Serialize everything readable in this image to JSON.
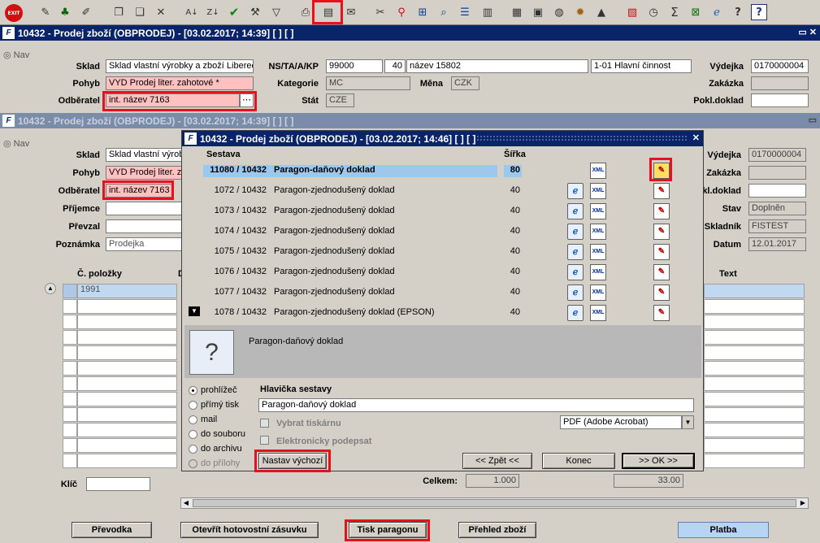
{
  "toolbar": {
    "exit_label": "EXIT",
    "icons": [
      "exit-icon",
      "new-record-icon",
      "tree-icon",
      "eraser-icon",
      "copy-icon",
      "paste-icon",
      "delete-icon",
      "sort-az-icon",
      "sort-za-icon",
      "check-icon",
      "wrench-icon",
      "filter-icon",
      "print-icon",
      "print-report-icon",
      "mail-icon",
      "cut-icon",
      "attach-icon",
      "tree-view-icon",
      "search-icon",
      "list-icon",
      "columns-icon",
      "table-icon",
      "report-icon",
      "globe-icon",
      "wheel-icon",
      "mountain-icon",
      "chart-icon",
      "clock-icon",
      "sum-icon",
      "excel-icon",
      "web-icon",
      "help-icon",
      "help-book-icon"
    ]
  },
  "back_window": {
    "title": "10432 - Prodej zboží (OBPRODEJ) - [03.02.2017; 14:39]  [ ]  [ ]",
    "nav": "Nav",
    "sklad_label": "Sklad",
    "sklad_value": "Sklad vlastní výrobky a zboží Liberec",
    "pohyb_label": "Pohyb",
    "pohyb_value": "VYD Prodej liter. zahotové *",
    "odberatel_label": "Odběratel",
    "odberatel_value": "int. název 7163",
    "nstakp_label": "NS/TA/A/KP",
    "nstakp_value1": "99000",
    "nstakp_value2": "40",
    "nstakp_value3": "název 15802",
    "nstakp_value4": "1-01 Hlavní činnost",
    "kategorie_label": "Kategorie",
    "kategorie_value": "MC",
    "mena_label": "Měna",
    "mena_value": "CZK",
    "stat_label": "Stát",
    "stat_value": "CZE",
    "vydejka_label": "Výdejka",
    "vydejka_value": "0170000004",
    "zakazka_label": "Zakázka",
    "pokl_label": "Pokl.doklad"
  },
  "mid_window": {
    "title": "10432 - Prodej zboží (OBPRODEJ) - [03.02.2017; 14:39]  [ ]  [ ]",
    "nav": "Nav",
    "sklad_label": "Sklad",
    "sklad_value": "Sklad vlastní výrob",
    "pohyb_label": "Pohyb",
    "pohyb_value": "VYD Prodej liter. z",
    "odberatel_label": "Odběratel",
    "odberatel_value": "int. název 7163",
    "prijemce_label": "Příjemce",
    "prevzal_label": "Převzal",
    "poznamka_label": "Poznámka",
    "poznamka_value": "Prodejka",
    "vydejka_label": "Výdejka",
    "vydejka_value": "0170000004",
    "zakazka_label": "Zakázka",
    "kldoklad_label": "kl.doklad",
    "stav_label": "Stav",
    "stav_value": "Doplněn",
    "skladnik_label": "Skladník",
    "skladnik_value": "FISTEST",
    "datum_label": "Datum",
    "datum_value": "12.01.2017",
    "col_cpolozky": "Č. položky",
    "col_d": "D",
    "col_text": "Text",
    "first_row_value": "1991",
    "klic_label": "Klíč",
    "celkem_label": "Celkem:",
    "celkem_value1": "1.000",
    "celkem_value2": "33.00"
  },
  "bottom_buttons": {
    "prevodka": "Převodka",
    "zasuvka": "Otevřít hotovostní zásuvku",
    "tisk": "Tisk paragonu",
    "prehled": "Přehled zboží",
    "platba": "Platba"
  },
  "dialog": {
    "title": "10432 - Prodej zboží (OBPRODEJ) - [03.02.2017; 14:46]  [ ]  [ ]",
    "col_sestava": "Sestava",
    "col_sirka": "Šířka",
    "rows": [
      {
        "code": "11080 / 10432",
        "name": "Paragon-daňový doklad",
        "width": "80"
      },
      {
        "code": "1072 / 10432",
        "name": "Paragon-zjednodušený doklad",
        "width": "40"
      },
      {
        "code": "1073 / 10432",
        "name": "Paragon-zjednodušený doklad",
        "width": "40"
      },
      {
        "code": "1074 / 10432",
        "name": "Paragon-zjednodušený doklad",
        "width": "40"
      },
      {
        "code": "1075 / 10432",
        "name": "Paragon-zjednodušený doklad",
        "width": "40"
      },
      {
        "code": "1076 / 10432",
        "name": "Paragon-zjednodušený doklad",
        "width": "40"
      },
      {
        "code": "1077 / 10432",
        "name": "Paragon-zjednodušený doklad",
        "width": "40"
      },
      {
        "code": "1078 / 10432",
        "name": "Paragon-zjednodušený doklad (EPSON)",
        "width": "40"
      }
    ],
    "xml_label": "XML",
    "preview_name": "Paragon-daňový doklad",
    "radios": [
      "prohlížeč",
      "přímý tisk",
      "mail",
      "do souboru",
      "do archivu",
      "do přílohy"
    ],
    "hlavicka_label": "Hlavička sestavy",
    "hlavicka_value": "Paragon-daňový doklad",
    "vybrat_label": "Vybrat tiskárnu",
    "podepsat_label": "Elektronicky podepsat",
    "format_value": "PDF (Adobe Acrobat)",
    "nastav_btn": "Nastav výchozí",
    "zpet_btn": "<< Zpět <<",
    "konec_btn": "Konec",
    "ok_btn": ">> OK >>"
  }
}
